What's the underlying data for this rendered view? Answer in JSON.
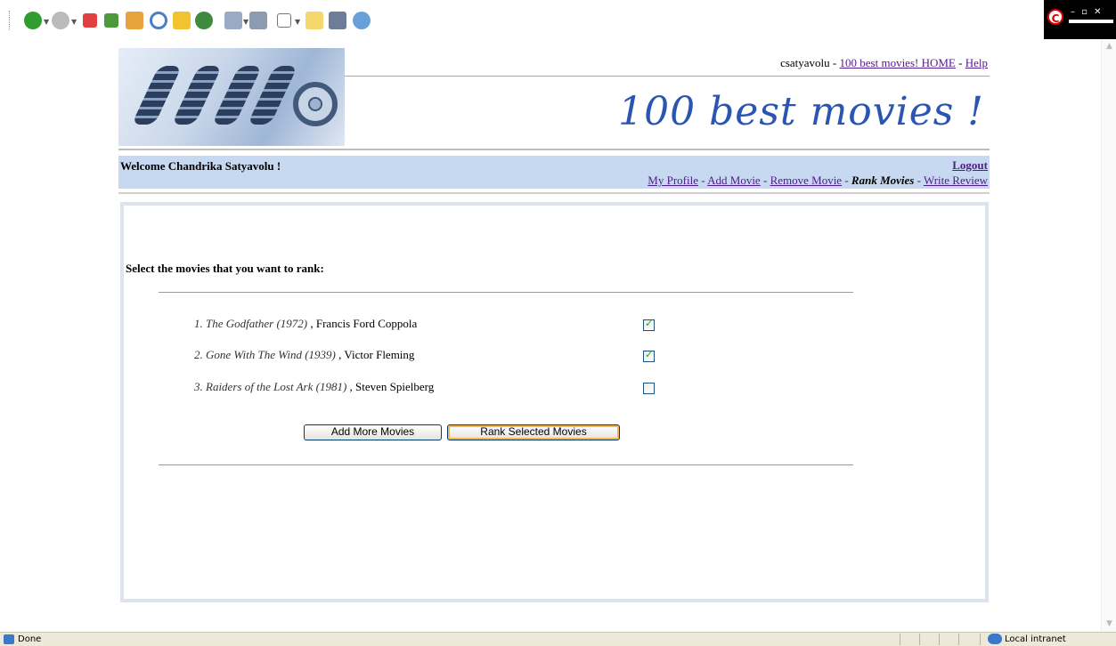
{
  "browser": {
    "status_text": "Done",
    "zone_text": "Local intranet"
  },
  "header": {
    "username": "csatyavolu",
    "separator": " - ",
    "home_link": "100 best movies! HOME",
    "help_link": "Help",
    "site_title": "100 best movies !"
  },
  "nav": {
    "welcome": "Welcome Chandrika Satyavolu !",
    "logout": "Logout",
    "links": {
      "my_profile": "My Profile",
      "add_movie": "Add Movie",
      "remove_movie": "Remove Movie",
      "rank_movies": "Rank Movies",
      "write_review": "Write Review"
    }
  },
  "main": {
    "prompt": "Select the movies that you want to rank:",
    "movies": [
      {
        "title": "1. The Godfather (1972)",
        "director": " , Francis Ford Coppola",
        "checked": true
      },
      {
        "title": "2. Gone With The Wind (1939)",
        "director": " , Victor Fleming",
        "checked": true
      },
      {
        "title": "3. Raiders of the Lost Ark (1981)",
        "director": " , Steven Spielberg",
        "checked": false
      }
    ],
    "add_more_button": "Add More Movies",
    "rank_selected_button": "Rank Selected Movies"
  },
  "colors": {
    "nav_background": "#c6d9f1",
    "title_blue": "#2a55b3",
    "visited_link": "#551a8b"
  }
}
